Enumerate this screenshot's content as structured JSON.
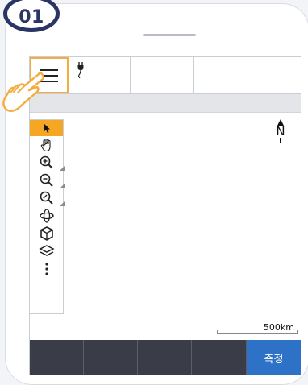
{
  "step": {
    "number": "01"
  },
  "app": {
    "toolbar": {
      "menu_icon": "hamburger-menu-icon",
      "power_icon": "power-plug-icon"
    },
    "tool_palette": [
      {
        "name": "select-arrow-icon",
        "active": true
      },
      {
        "name": "pan-hand-icon",
        "active": false
      },
      {
        "name": "zoom-in-icon",
        "active": false,
        "has_submenu": true
      },
      {
        "name": "zoom-out-icon",
        "active": false,
        "has_submenu": true
      },
      {
        "name": "zoom-extents-icon",
        "active": false,
        "has_submenu": true
      },
      {
        "name": "orbit-icon",
        "active": false
      },
      {
        "name": "3d-cube-icon",
        "active": false
      },
      {
        "name": "layers-icon",
        "active": false
      },
      {
        "name": "more-vertical-icon",
        "active": false
      }
    ],
    "north_indicator": {
      "label": "N"
    },
    "scale_bar": {
      "label": "500km"
    },
    "bottom_bar": {
      "measure_label": "측정"
    }
  },
  "colors": {
    "badge": "#2a3566",
    "highlight": "#f4ad3d",
    "active_tool": "#f5a623",
    "bottom_bar": "#3a3d47",
    "measure_button": "#2d72c7"
  }
}
